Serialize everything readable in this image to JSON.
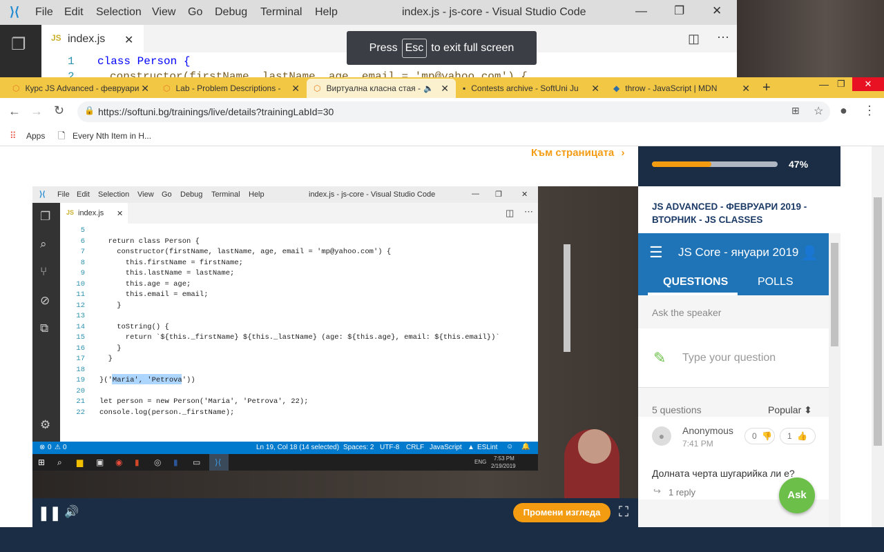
{
  "vscode_bg": {
    "menu": [
      "File",
      "Edit",
      "Selection",
      "View",
      "Go",
      "Debug",
      "Terminal",
      "Help"
    ],
    "title": "index.js - js-core - Visual Studio Code",
    "tab_label": "index.js",
    "line_number": "1",
    "code_line": "class Person {",
    "code_line_partial": "constructor(firstName, lastName, age, email = 'mp@yahoo.com') {",
    "line_number_2": "2",
    "tab_prefix": "JS"
  },
  "toast": {
    "before": "Press",
    "key": "Esc",
    "after": "to exit full screen"
  },
  "chrome": {
    "tabs": [
      {
        "label": "Курс JS Advanced - февруари"
      },
      {
        "label": "Lab - Problem Descriptions -"
      },
      {
        "label": "Виртуална класна стая -"
      },
      {
        "label": "Contests archive - SoftUni Ju"
      },
      {
        "label": "throw - JavaScript | MDN"
      }
    ],
    "url": "https://softuni.bg/trainings/live/details?trainingLabId=30",
    "bookmarks": [
      "Apps",
      "Every Nth Item in H..."
    ]
  },
  "page": {
    "top_link": "Към страницата",
    "change_view": "Промени изгледа",
    "progress_percent": 47,
    "progress_label": "47%",
    "session_title": "JS ADVANCED - ФЕВРУАРИ 2019 - ВТОРНИК - JS CLASSES"
  },
  "inner_vscode": {
    "menu": [
      "File",
      "Edit",
      "Selection",
      "View",
      "Go",
      "Debug",
      "Terminal",
      "Help"
    ],
    "title": "index.js - js-core - Visual Studio Code",
    "tab_label": "index.js",
    "lines": [
      {
        "n": "5",
        "t": ""
      },
      {
        "n": "6",
        "t": "  return class Person {"
      },
      {
        "n": "7",
        "t": "    constructor(firstName, lastName, age, email = 'mp@yahoo.com') {"
      },
      {
        "n": "8",
        "t": "      this.firstName = firstName;"
      },
      {
        "n": "9",
        "t": "      this.lastName = lastName;"
      },
      {
        "n": "10",
        "t": "      this.age = age;"
      },
      {
        "n": "11",
        "t": "      this.email = email;"
      },
      {
        "n": "12",
        "t": "    }"
      },
      {
        "n": "13",
        "t": ""
      },
      {
        "n": "14",
        "t": "    toString() {"
      },
      {
        "n": "15",
        "t": "      return `${this._firstName} ${this._lastName} (age: ${this.age}, email: ${this.email})`"
      },
      {
        "n": "16",
        "t": "    }"
      },
      {
        "n": "17",
        "t": "  }"
      },
      {
        "n": "18",
        "t": ""
      },
      {
        "n": "19",
        "t": "}('Maria', 'Petrova'))"
      },
      {
        "n": "20",
        "t": ""
      },
      {
        "n": "21",
        "t": "let person = new Person('Maria', 'Petrova', 22);"
      },
      {
        "n": "22",
        "t": "console.log(person._firstName);"
      }
    ],
    "status": {
      "errors": "0",
      "warnings": "0",
      "position": "Ln 19, Col 18 (14 selected)",
      "spaces": "Spaces: 2",
      "encoding": "UTF-8",
      "eol": "CRLF",
      "language": "JavaScript",
      "lint": "ESLint"
    },
    "clock_time": "7:53 PM",
    "clock_date": "2/19/2019",
    "lang": "ENG"
  },
  "slido": {
    "event_title": "JS Core - януари 2019",
    "tabs": [
      "QUESTIONS",
      "POLLS"
    ],
    "ask_label": "Ask the speaker",
    "placeholder": "Type your question",
    "count_label": "5 questions",
    "sort_label": "Popular",
    "question": {
      "author": "Anonymous",
      "time": "7:41 PM",
      "text": "Долната черта шугарийка ли е?",
      "downvotes": "0",
      "upvotes": "1",
      "replies": "1 reply"
    },
    "ask_button": "Ask"
  },
  "colors": {
    "accent": "#f39c12",
    "slido_blue": "#1f73b7",
    "chrome_tabs": "#f2c744",
    "ask_green": "#6cc04a"
  }
}
